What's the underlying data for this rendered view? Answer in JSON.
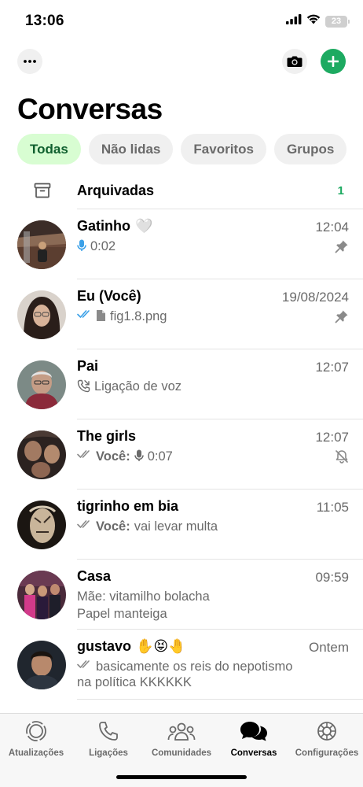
{
  "status_bar": {
    "time": "13:06",
    "battery": "23"
  },
  "header": {
    "title": "Conversas"
  },
  "filters": [
    {
      "label": "Todas",
      "active": true
    },
    {
      "label": "Não lidas",
      "active": false
    },
    {
      "label": "Favoritos",
      "active": false
    },
    {
      "label": "Grupos",
      "active": false
    }
  ],
  "archived": {
    "label": "Arquivadas",
    "count": "1"
  },
  "chats": [
    {
      "name": "Gatinho",
      "emoji": "🤍",
      "time": "12:04",
      "preview_icon": "mic-icon",
      "preview": "0:02",
      "pinned": true
    },
    {
      "name": "Eu (Você)",
      "time": "19/08/2024",
      "preview_icon": "double-check-icon",
      "preview_icon_2": "document-icon",
      "preview": "fig1.8.png",
      "pinned": true
    },
    {
      "name": "Pai",
      "time": "12:07",
      "preview_icon": "call-icon",
      "preview": "Ligação de voz"
    },
    {
      "name": "The girls",
      "time": "12:07",
      "preview_icon": "double-check-icon",
      "preview_prefix": "Você:",
      "preview_icon_2": "mic-icon",
      "preview": "0:07",
      "muted": true
    },
    {
      "name": "tigrinho em bia",
      "time": "11:05",
      "preview_icon": "double-check-icon",
      "preview_prefix": "Você:",
      "preview": "vai levar multa"
    },
    {
      "name": "Casa",
      "time": "09:59",
      "preview": "Mãe: vitamilho bolacha",
      "preview_line2": "Papel manteiga"
    },
    {
      "name": "gustavo",
      "emoji": "✋😝🤚",
      "time": "Ontem",
      "preview_icon": "double-check-icon",
      "preview": "basicamente os reis do nepotismo",
      "preview_line2": "na política KKKKKK"
    }
  ],
  "tabs": [
    {
      "label": "Atualizações",
      "icon": "updates-icon"
    },
    {
      "label": "Ligações",
      "icon": "phone-icon"
    },
    {
      "label": "Comunidades",
      "icon": "communities-icon"
    },
    {
      "label": "Conversas",
      "icon": "chats-icon",
      "active": true
    },
    {
      "label": "Configurações",
      "icon": "settings-icon"
    }
  ],
  "colors": {
    "accent": "#1daa61",
    "chip_active_bg": "#d8fdd2",
    "chip_active_text": "#0f5f2e",
    "read_ticks": "#3aa0e8",
    "secondary_text": "#6a6a6a"
  }
}
